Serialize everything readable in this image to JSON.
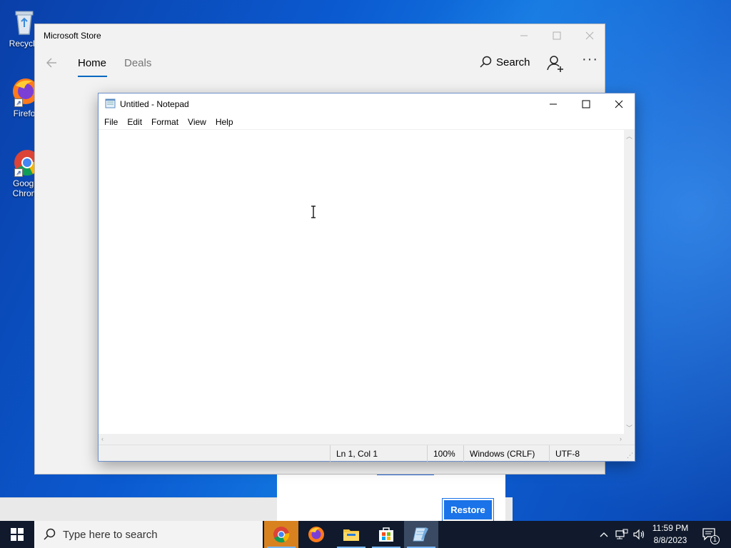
{
  "desktop": {
    "icons": [
      {
        "label": "Recycle"
      },
      {
        "label": "Firefo"
      },
      {
        "label": "Googl",
        "label2": "Chron"
      }
    ]
  },
  "store": {
    "title": "Microsoft Store",
    "tabs": [
      {
        "label": "Home",
        "active": true
      },
      {
        "label": "Deals",
        "active": false
      }
    ],
    "search_label": "Search",
    "more_label": "···"
  },
  "restore_dialog": {
    "restore_label": "Restore"
  },
  "notepad": {
    "title": "Untitled - Notepad",
    "menu": [
      "File",
      "Edit",
      "Format",
      "View",
      "Help"
    ],
    "content": "",
    "status": {
      "position": "Ln 1, Col 1",
      "zoom": "100%",
      "line_ending": "Windows (CRLF)",
      "encoding": "UTF-8"
    }
  },
  "taskbar": {
    "search_placeholder": "Type here to search",
    "apps": [
      "chrome-icon",
      "firefox-icon",
      "file-explorer-icon",
      "microsoft-store-icon",
      "notepad-icon"
    ],
    "clock_time": "11:59 PM",
    "clock_date": "8/8/2023",
    "notification_count": "1"
  }
}
